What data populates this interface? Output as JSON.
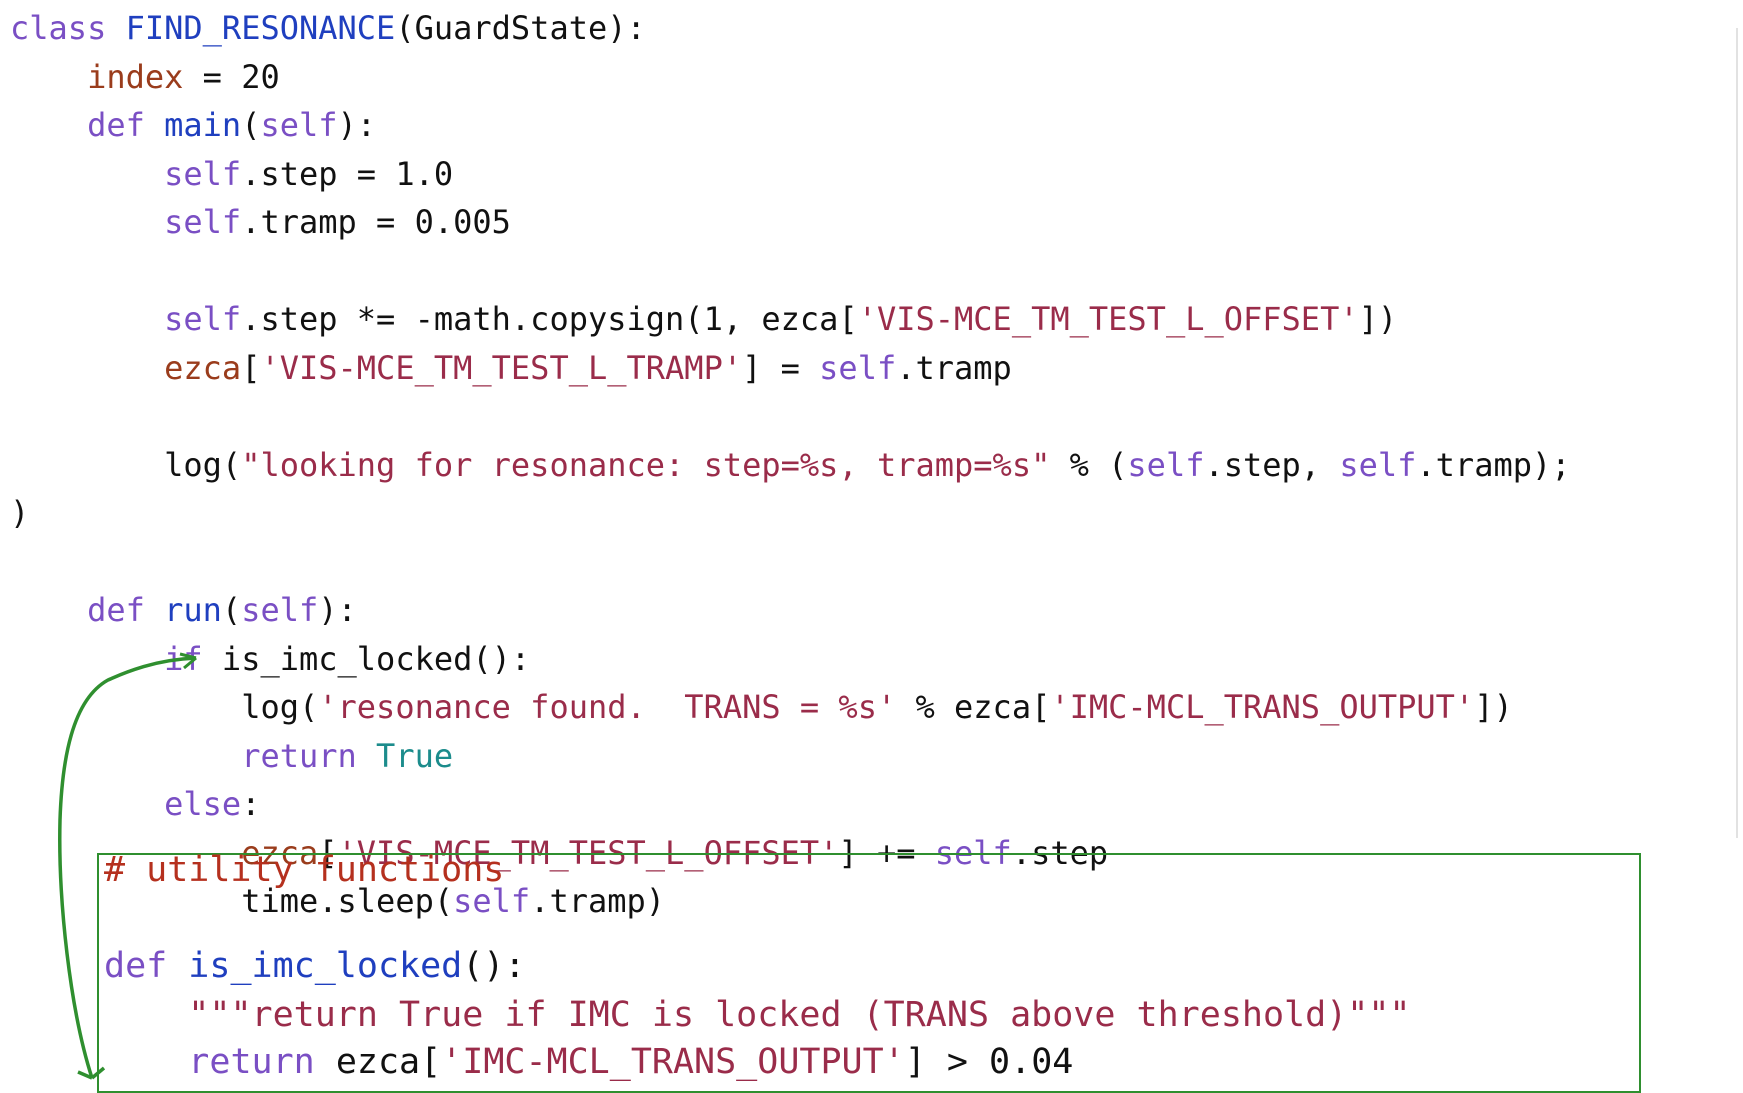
{
  "code": {
    "lines": [
      {
        "i": 0,
        "tokens": [
          [
            "kw",
            "class "
          ],
          [
            "name",
            "FIND_RESONANCE"
          ],
          [
            "plain",
            "(GuardState):"
          ]
        ]
      },
      {
        "i": 1,
        "tokens": [
          [
            "plain",
            "    "
          ],
          [
            "var",
            "index"
          ],
          [
            "plain",
            " = 20"
          ]
        ]
      },
      {
        "i": 2,
        "tokens": [
          [
            "plain",
            "    "
          ],
          [
            "kw",
            "def "
          ],
          [
            "name",
            "main"
          ],
          [
            "plain",
            "("
          ],
          [
            "kw",
            "self"
          ],
          [
            "plain",
            "):"
          ]
        ]
      },
      {
        "i": 3,
        "tokens": [
          [
            "plain",
            "        "
          ],
          [
            "kw",
            "self"
          ],
          [
            "plain",
            ".step = 1.0"
          ]
        ]
      },
      {
        "i": 4,
        "tokens": [
          [
            "plain",
            "        "
          ],
          [
            "kw",
            "self"
          ],
          [
            "plain",
            ".tramp = 0.005"
          ]
        ]
      },
      {
        "i": 6,
        "tokens": [
          [
            "plain",
            "        "
          ],
          [
            "kw",
            "self"
          ],
          [
            "plain",
            ".step *= -math.copysign(1, ezca["
          ],
          [
            "str",
            "'VIS-MCE_TM_TEST_L_OFFSET'"
          ],
          [
            "plain",
            "])"
          ]
        ]
      },
      {
        "i": 7,
        "tokens": [
          [
            "plain",
            "        "
          ],
          [
            "var",
            "ezca"
          ],
          [
            "plain",
            "["
          ],
          [
            "str",
            "'VIS-MCE_TM_TEST_L_TRAMP'"
          ],
          [
            "plain",
            "] = "
          ],
          [
            "kw",
            "self"
          ],
          [
            "plain",
            ".tramp"
          ]
        ]
      },
      {
        "i": 9,
        "tokens": [
          [
            "plain",
            "        log("
          ],
          [
            "str",
            "\"looking for resonance: step=%s, tramp=%s\""
          ],
          [
            "plain",
            " % ("
          ],
          [
            "kw",
            "self"
          ],
          [
            "plain",
            ".step, "
          ],
          [
            "kw",
            "self"
          ],
          [
            "plain",
            ".tramp);"
          ]
        ]
      },
      {
        "i": 10,
        "tokens": [
          [
            "plain",
            ")"
          ]
        ]
      },
      {
        "i": 12,
        "tokens": [
          [
            "plain",
            "    "
          ],
          [
            "kw",
            "def "
          ],
          [
            "name",
            "run"
          ],
          [
            "plain",
            "("
          ],
          [
            "kw",
            "self"
          ],
          [
            "plain",
            "):"
          ]
        ]
      },
      {
        "i": 13,
        "tokens": [
          [
            "plain",
            "        "
          ],
          [
            "kw",
            "if"
          ],
          [
            "plain",
            " is_imc_locked():"
          ]
        ]
      },
      {
        "i": 14,
        "tokens": [
          [
            "plain",
            "            log("
          ],
          [
            "str",
            "'resonance found.  TRANS = %s'"
          ],
          [
            "plain",
            " % ezca["
          ],
          [
            "str",
            "'IMC-MCL_TRANS_OUTPUT'"
          ],
          [
            "plain",
            "])"
          ]
        ]
      },
      {
        "i": 15,
        "tokens": [
          [
            "plain",
            "            "
          ],
          [
            "kw",
            "return "
          ],
          [
            "const",
            "True"
          ]
        ]
      },
      {
        "i": 16,
        "tokens": [
          [
            "plain",
            "        "
          ],
          [
            "kw",
            "else"
          ],
          [
            "plain",
            ":"
          ]
        ]
      },
      {
        "i": 17,
        "tokens": [
          [
            "plain",
            "            "
          ],
          [
            "var",
            "ezca"
          ],
          [
            "plain",
            "["
          ],
          [
            "str",
            "'VIS-MCE_TM_TEST_L_OFFSET'"
          ],
          [
            "plain",
            "] += "
          ],
          [
            "kw",
            "self"
          ],
          [
            "plain",
            ".step"
          ]
        ]
      },
      {
        "i": 18,
        "tokens": [
          [
            "plain",
            "            time.sleep("
          ],
          [
            "kw",
            "self"
          ],
          [
            "plain",
            ".tramp)"
          ]
        ]
      }
    ],
    "boxed_lines": [
      {
        "id": "box-line-1",
        "tokens": [
          [
            "cm",
            "# utility functions"
          ]
        ]
      },
      {
        "id": "box-line-2",
        "tokens": [
          [
            "kw",
            "def "
          ],
          [
            "name",
            "is_imc_locked"
          ],
          [
            "plain",
            "():"
          ]
        ]
      },
      {
        "id": "box-line-3",
        "tokens": [
          [
            "plain",
            "    "
          ],
          [
            "str",
            "\"\"\"return True if IMC is locked (TRANS above threshold)\"\"\""
          ]
        ]
      },
      {
        "id": "box-line-4",
        "tokens": [
          [
            "plain",
            "    "
          ],
          [
            "kw",
            "return "
          ],
          [
            "plain",
            "ezca["
          ],
          [
            "str",
            "'IMC-MCL_TRANS_OUTPUT'"
          ],
          [
            "plain",
            "] > 0.04"
          ]
        ]
      }
    ]
  },
  "colors": {
    "keyword": "#7a4fc4",
    "function_name": "#1f3fbf",
    "string": "#9a2c4a",
    "variable": "#9a3c1c",
    "constant": "#1c8c8c",
    "comment": "#b5301e",
    "annotation": "#2f8f2f"
  }
}
